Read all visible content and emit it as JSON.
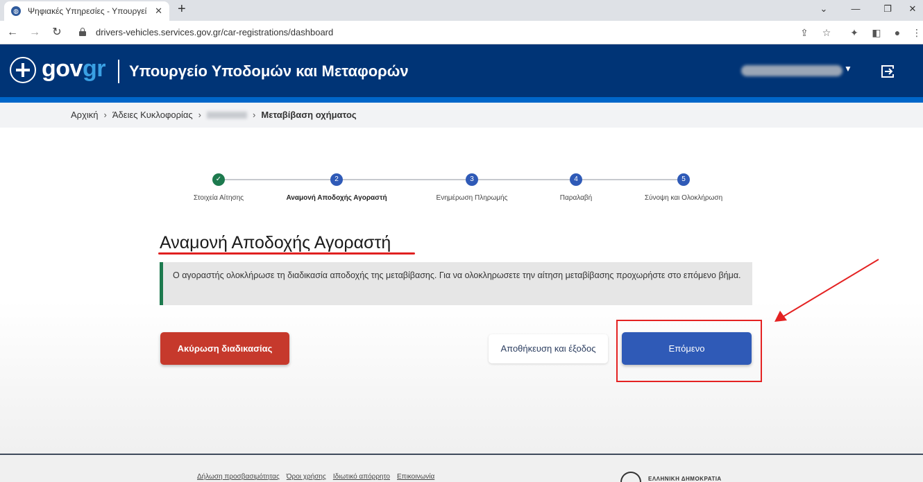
{
  "browser": {
    "tab_title": "Ψηφιακές Υπηρεσίες - Υπουργεί",
    "url": "drivers-vehicles.services.gov.gr/car-registrations/dashboard"
  },
  "header": {
    "logo_gov": "gov",
    "logo_gr": "gr",
    "ministry": "Υπουργείο Υποδομών και Μεταφορών"
  },
  "breadcrumb": {
    "home": "Αρχική",
    "licenses": "Άδειες Κυκλοφορίας",
    "current": "Μεταβίβαση οχήματος"
  },
  "stepper": {
    "steps": [
      {
        "label": "Στοιχεία Αίτησης",
        "number": "✓",
        "state": "done"
      },
      {
        "label": "Αναμονή Αποδοχής Αγοραστή",
        "number": "2",
        "state": "active"
      },
      {
        "label": "Ενημέρωση Πληρωμής",
        "number": "3",
        "state": "pending"
      },
      {
        "label": "Παραλαβή",
        "number": "4",
        "state": "pending"
      },
      {
        "label": "Σύνοψη και Ολοκλήρωση",
        "number": "5",
        "state": "pending"
      }
    ]
  },
  "main": {
    "title": "Αναμονή Αποδοχής Αγοραστή",
    "alert_text": "Ο αγοραστής ολοκλήρωσε τη διαδικασία αποδοχής της μεταβίβασης. Για να ολοκληρωσετε την αίτηση μεταβίβασης προχωρήστε στο επόμενο βήμα."
  },
  "buttons": {
    "cancel": "Ακύρωση διαδικασίας",
    "save_exit": "Αποθήκευση και έξοδος",
    "next": "Επόμενο"
  },
  "footer": {
    "links": [
      "Δήλωση προσβασιμότητας",
      "Όροι χρήσης",
      "Ιδιωτικό απόρρητο",
      "Επικοινωνία"
    ],
    "republic": "ΕΛΛΗΝΙΚΗ ΔΗΜΟΚΡΑΤΙΑ"
  },
  "colors": {
    "header_bg": "#003476",
    "step_done": "#1d7a4e",
    "step_active": "#2f5ab7",
    "cancel_btn": "#c6392c",
    "next_btn": "#2f5ab7",
    "annotation": "#e42222"
  },
  "icons": {
    "tab_favicon": "globe-icon",
    "back": "arrow-left-icon",
    "forward": "arrow-right-icon",
    "reload": "reload-icon",
    "lock": "lock-icon",
    "share": "share-icon",
    "bookmark": "star-icon",
    "extensions": "puzzle-icon",
    "sidebar": "sidebar-icon",
    "profile": "profile-icon",
    "menu": "kebab-menu-icon",
    "logout": "logout-icon"
  }
}
